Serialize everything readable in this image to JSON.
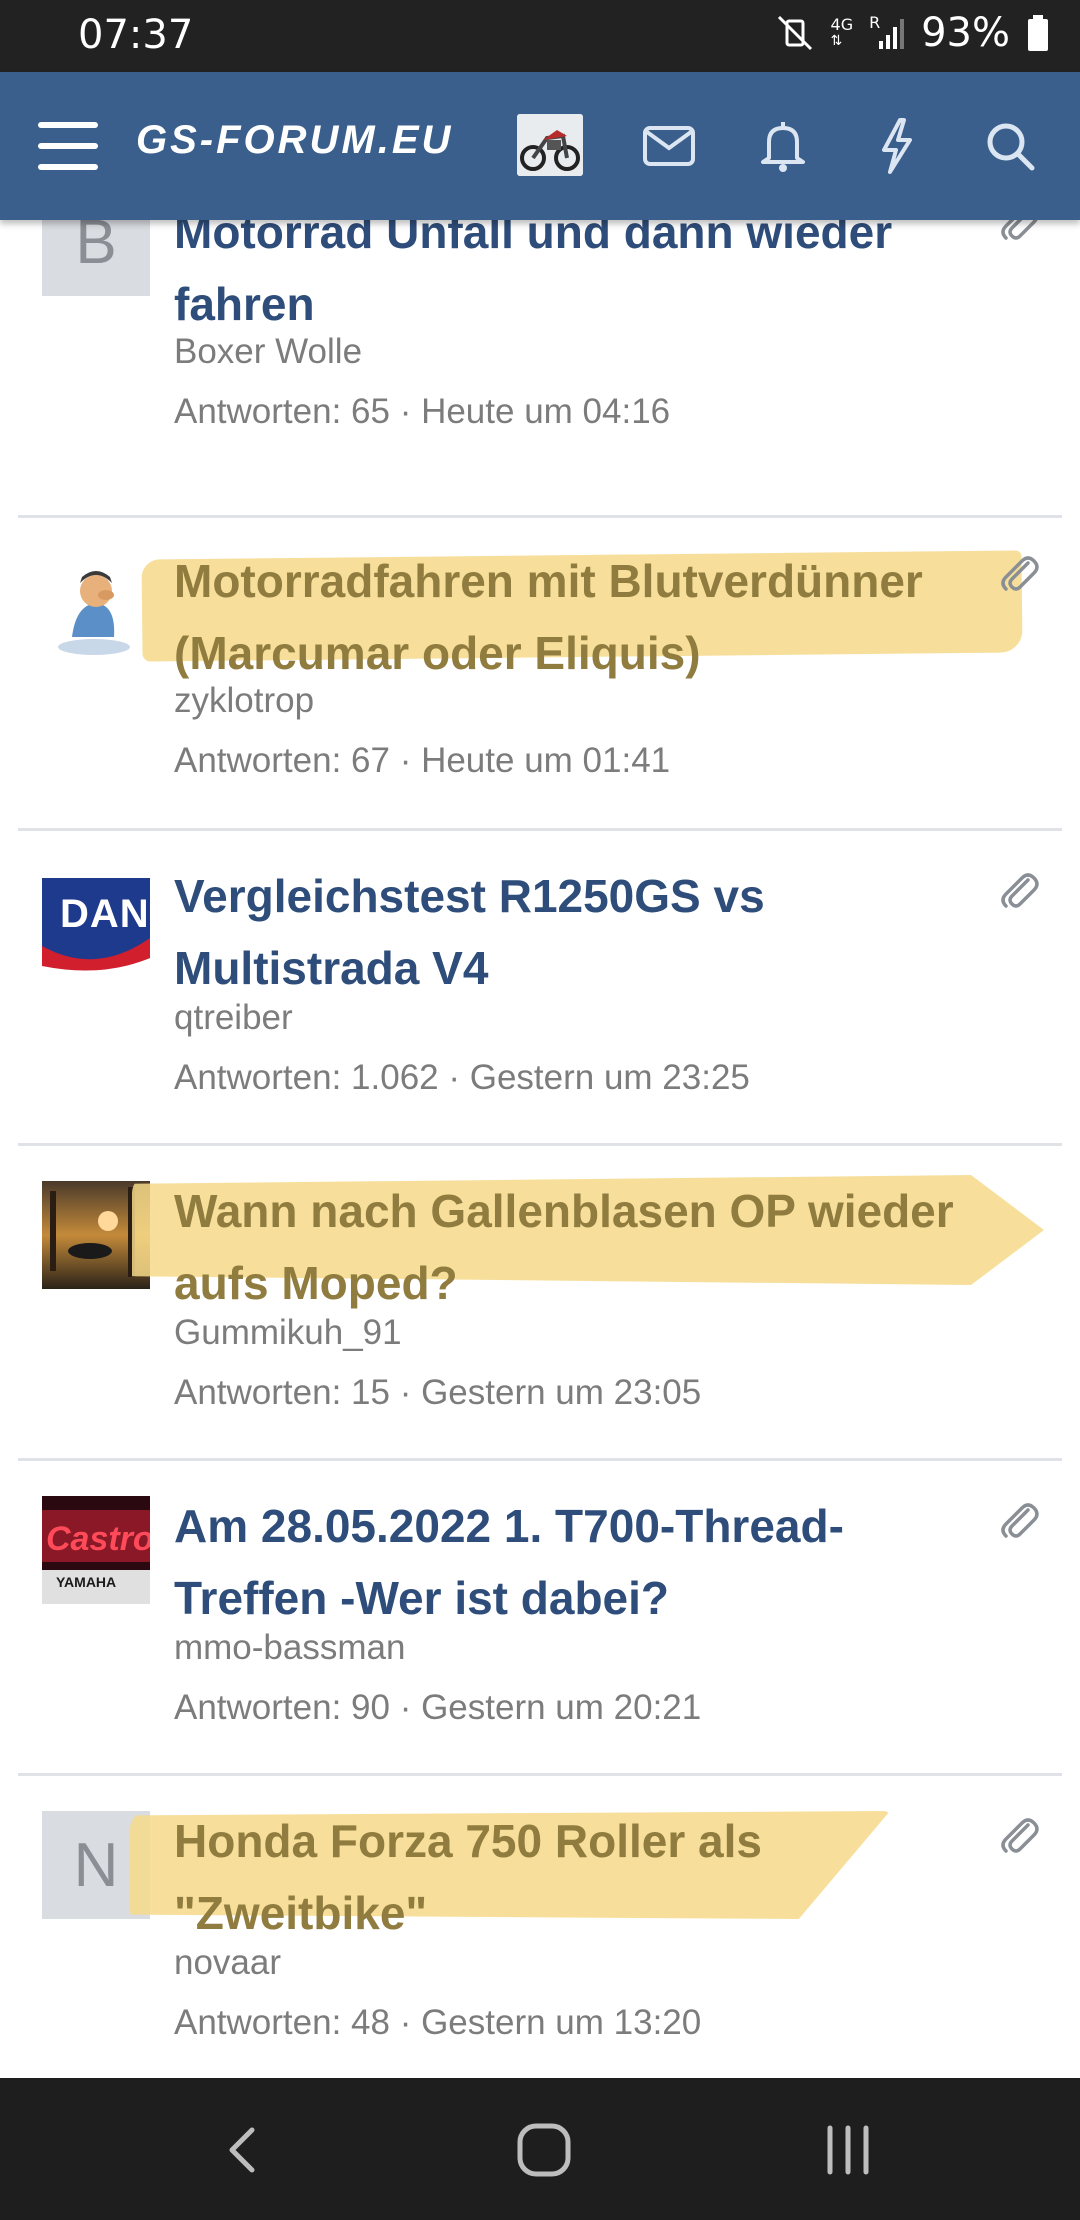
{
  "status_bar": {
    "time": "07:37",
    "network": "4G",
    "roaming": "R",
    "battery": "93%"
  },
  "header": {
    "site_name": "GS-FORUM.EU",
    "menu_icon": "menu-icon",
    "icons": [
      "mail-icon",
      "bell-icon",
      "bolt-icon",
      "search-icon"
    ],
    "bg_color": "#3a5f8c"
  },
  "threads": [
    {
      "avatar_letter": "B",
      "title": "Motorrad Unfall und dann wieder fahren",
      "author": "Boxer Wolle",
      "meta": "Antworten: 65 · Heute um 04:16",
      "attachment": true,
      "highlighted": false
    },
    {
      "avatar_letter": "",
      "title": "Motorradfahren mit Blutverdünner (Marcumar oder Eliquis)",
      "author": "zyklotrop",
      "meta": "Antworten: 67 · Heute um 01:41",
      "attachment": true,
      "highlighted": true
    },
    {
      "avatar_letter": "",
      "avatar_text": "DAN",
      "title": "Vergleichstest R1250GS vs Multistrada V4",
      "author": "qtreiber",
      "meta": "Antworten: 1.062 · Gestern um 23:25",
      "attachment": true,
      "highlighted": false
    },
    {
      "avatar_letter": "",
      "title": "Wann nach Gallenblasen OP wieder aufs Moped?",
      "author": "Gummikuh_91",
      "meta": "Antworten: 15 · Gestern um 23:05",
      "attachment": false,
      "highlighted": true
    },
    {
      "avatar_letter": "",
      "avatar_text": "Castro",
      "avatar_subtext": "YAMAHA",
      "title": "Am 28.05.2022 1. T700-Thread-Treffen -Wer ist dabei?",
      "author": "mmo-bassman",
      "meta": "Antworten: 90 · Gestern um 20:21",
      "attachment": true,
      "highlighted": false
    },
    {
      "avatar_letter": "N",
      "title": "Honda Forza 750 Roller als \"Zweitbike\"",
      "author": "novaar",
      "meta": "Antworten: 48 · Gestern um 13:20",
      "attachment": true,
      "highlighted": true
    }
  ],
  "nav_bar": {
    "icons": [
      "back-icon",
      "home-icon",
      "recents-icon"
    ]
  }
}
